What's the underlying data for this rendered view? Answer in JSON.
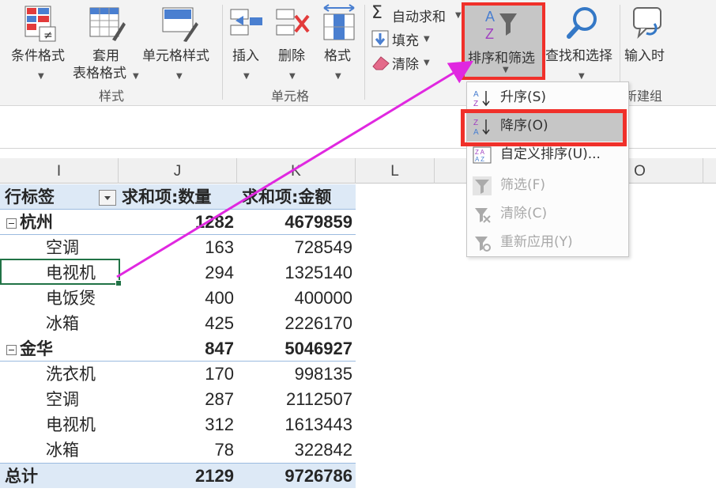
{
  "ribbon": {
    "styles_group": {
      "label": "样式",
      "buttons": [
        {
          "name": "conditional-format",
          "label": "条件格式"
        },
        {
          "name": "format-as-table",
          "label_line1": "套用",
          "label_line2": "表格格式"
        },
        {
          "name": "cell-styles",
          "label": "单元格样式"
        }
      ]
    },
    "cells_group": {
      "label": "单元格",
      "buttons": [
        {
          "name": "insert",
          "label": "插入"
        },
        {
          "name": "delete",
          "label": "删除"
        },
        {
          "name": "format",
          "label": "格式"
        }
      ]
    },
    "editing_group": {
      "autosum": "自动求和",
      "fill": "填充",
      "clear": "清除",
      "sort_filter": "排序和筛选",
      "find_select": "查找和选择"
    },
    "new_group": {
      "label": "新建组",
      "input_button": "输入时"
    }
  },
  "sort_menu": {
    "items": [
      {
        "label": "升序(S)",
        "icon": "sort-ascending-icon",
        "enabled": true
      },
      {
        "label": "降序(O)",
        "icon": "sort-descending-icon",
        "enabled": true,
        "highlighted": true
      },
      {
        "label": "自定义排序(U)...",
        "icon": "custom-sort-icon",
        "enabled": true
      },
      {
        "label": "筛选(F)",
        "icon": "filter-icon",
        "enabled": false
      },
      {
        "label": "清除(C)",
        "icon": "clear-filter-icon",
        "enabled": false
      },
      {
        "label": "重新应用(Y)",
        "icon": "reapply-icon",
        "enabled": false
      }
    ]
  },
  "columns": [
    "I",
    "J",
    "K",
    "L",
    "O"
  ],
  "pivot": {
    "headers": {
      "label": "行标签",
      "qty": "求和项:数量",
      "amount": "求和项:金额"
    },
    "rows": [
      {
        "type": "group",
        "label": "杭州",
        "qty": "1282",
        "amount": "4679859"
      },
      {
        "type": "item",
        "label": "空调",
        "qty": "163",
        "amount": "728549"
      },
      {
        "type": "item",
        "label": "电视机",
        "qty": "294",
        "amount": "1325140"
      },
      {
        "type": "item",
        "label": "电饭煲",
        "qty": "400",
        "amount": "400000"
      },
      {
        "type": "item",
        "label": "冰箱",
        "qty": "425",
        "amount": "2226170"
      },
      {
        "type": "group",
        "label": "金华",
        "qty": "847",
        "amount": "5046927"
      },
      {
        "type": "item",
        "label": "洗衣机",
        "qty": "170",
        "amount": "998135"
      },
      {
        "type": "item",
        "label": "空调",
        "qty": "287",
        "amount": "2112507"
      },
      {
        "type": "item",
        "label": "电视机",
        "qty": "312",
        "amount": "1613443"
      },
      {
        "type": "item",
        "label": "冰箱",
        "qty": "78",
        "amount": "322842"
      }
    ],
    "total": {
      "label": "总计",
      "qty": "2129",
      "amount": "9726786"
    }
  },
  "colors": {
    "highlight_red": "#f0302a",
    "arrow_magenta": "#e028e0",
    "pivot_header_bg": "#dde9f6",
    "selection_green": "#217346"
  }
}
